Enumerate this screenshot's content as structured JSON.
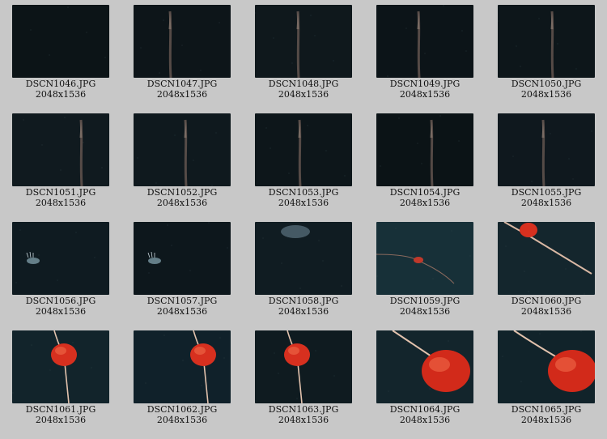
{
  "gallery": {
    "items": [
      {
        "filename": "DSCN1046.JPG",
        "dimensions": "2048x1536",
        "scene": "empty-dark",
        "bg": "#0c1417"
      },
      {
        "filename": "DSCN1047.JPG",
        "dimensions": "2048x1536",
        "scene": "siphonophore-stem",
        "bg": "#0d1519"
      },
      {
        "filename": "DSCN1048.JPG",
        "dimensions": "2048x1536",
        "scene": "siphonophore-stem",
        "bg": "#0f181c"
      },
      {
        "filename": "DSCN1049.JPG",
        "dimensions": "2048x1536",
        "scene": "siphonophore-stem",
        "bg": "#0c1418"
      },
      {
        "filename": "DSCN1050.JPG",
        "dimensions": "2048x1536",
        "scene": "siphonophore-stem",
        "bg": "#0d161a"
      },
      {
        "filename": "DSCN1051.JPG",
        "dimensions": "2048x1536",
        "scene": "siphonophore-stem",
        "bg": "#101a1f"
      },
      {
        "filename": "DSCN1052.JPG",
        "dimensions": "2048x1536",
        "scene": "siphonophore-stem",
        "bg": "#0f191e"
      },
      {
        "filename": "DSCN1053.JPG",
        "dimensions": "2048x1536",
        "scene": "siphonophore-stem",
        "bg": "#0d161a"
      },
      {
        "filename": "DSCN1054.JPG",
        "dimensions": "2048x1536",
        "scene": "siphonophore-stem",
        "bg": "#0b1316"
      },
      {
        "filename": "DSCN1055.JPG",
        "dimensions": "2048x1536",
        "scene": "siphonophore-stem",
        "bg": "#0f181e"
      },
      {
        "filename": "DSCN1056.JPG",
        "dimensions": "2048x1536",
        "scene": "small-creature",
        "bg": "#0f1b21"
      },
      {
        "filename": "DSCN1057.JPG",
        "dimensions": "2048x1536",
        "scene": "small-creature",
        "bg": "#0d171c"
      },
      {
        "filename": "DSCN1058.JPG",
        "dimensions": "2048x1536",
        "scene": "jelly-top",
        "bg": "#101c22"
      },
      {
        "filename": "DSCN1059.JPG",
        "dimensions": "2048x1536",
        "scene": "red-small-tendril",
        "bg": "#173038"
      },
      {
        "filename": "DSCN1060.JPG",
        "dimensions": "2048x1536",
        "scene": "red-top-tendril",
        "bg": "#14262d"
      },
      {
        "filename": "DSCN1061.JPG",
        "dimensions": "2048x1536",
        "scene": "red-jelly",
        "bg": "#12242b"
      },
      {
        "filename": "DSCN1062.JPG",
        "dimensions": "2048x1536",
        "scene": "red-jelly",
        "bg": "#10212a"
      },
      {
        "filename": "DSCN1063.JPG",
        "dimensions": "2048x1536",
        "scene": "red-jelly",
        "bg": "#0f1b20"
      },
      {
        "filename": "DSCN1064.JPG",
        "dimensions": "2048x1536",
        "scene": "red-jelly-large",
        "bg": "#13252c"
      },
      {
        "filename": "DSCN1065.JPG",
        "dimensions": "2048x1536",
        "scene": "red-jelly-large",
        "bg": "#11232a"
      }
    ]
  }
}
